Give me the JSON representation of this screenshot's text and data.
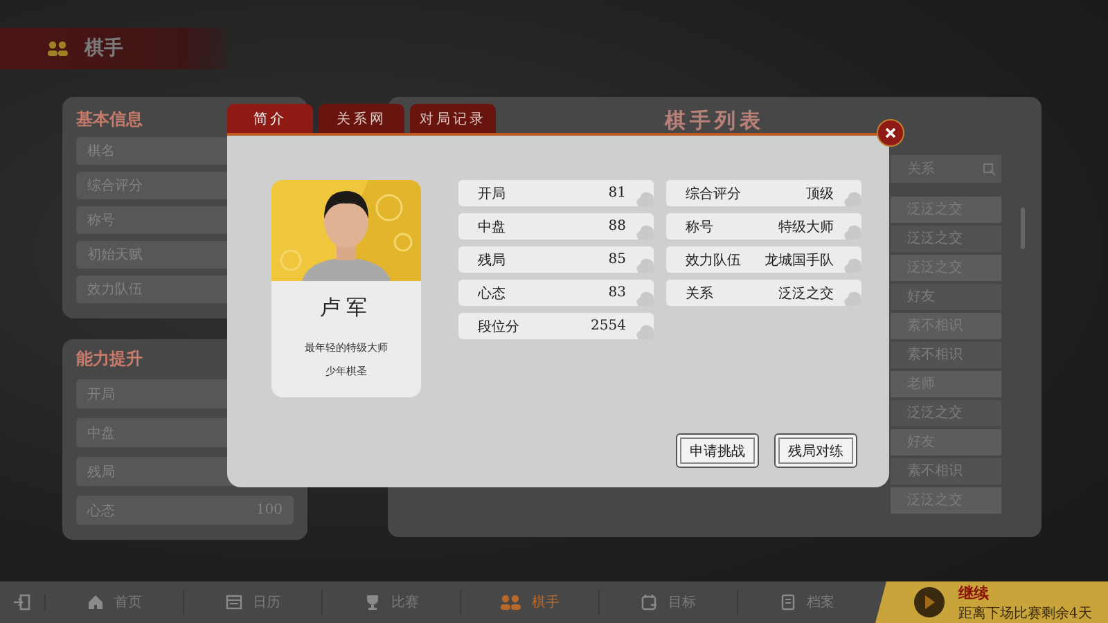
{
  "header": {
    "title": "棋手"
  },
  "basic_info": {
    "title": "基本信息",
    "rows": [
      {
        "label": "棋名"
      },
      {
        "label": "综合评分"
      },
      {
        "label": "称号"
      },
      {
        "label": "初始天赋"
      },
      {
        "label": "效力队伍"
      }
    ]
  },
  "ability": {
    "title": "能力提升",
    "rows": [
      {
        "label": "开局"
      },
      {
        "label": "中盘"
      },
      {
        "label": "残局"
      },
      {
        "label": "心态",
        "value": "100"
      }
    ]
  },
  "player_list": {
    "title": "棋手列表",
    "column": "关系",
    "cells": [
      "泛泛之交",
      "泛泛之交",
      "泛泛之交",
      "好友",
      "素不相识",
      "素不相识",
      "老师",
      "泛泛之交",
      "好友",
      "素不相识",
      "泛泛之交"
    ]
  },
  "nav": [
    {
      "label": "首页",
      "selected": false
    },
    {
      "label": "日历",
      "selected": false
    },
    {
      "label": "比赛",
      "selected": false
    },
    {
      "label": "棋手",
      "selected": true
    },
    {
      "label": "目标",
      "selected": false
    },
    {
      "label": "档案",
      "selected": false
    }
  ],
  "continue": {
    "label": "继续",
    "subtitle": "距离下场比赛剩余4天"
  },
  "dialog": {
    "tabs": [
      {
        "label": "简介",
        "selected": true
      },
      {
        "label": "关系网",
        "selected": false
      },
      {
        "label": "对局记录",
        "selected": false
      }
    ],
    "player": {
      "name": "卢军",
      "bio": [
        "最年轻的特级大师",
        "少年棋圣"
      ]
    },
    "stats": [
      {
        "label": "开局",
        "value": "81"
      },
      {
        "label": "中盘",
        "value": "88"
      },
      {
        "label": "残局",
        "value": "85"
      },
      {
        "label": "心态",
        "value": "83"
      },
      {
        "label": "段位分",
        "value": "2554"
      }
    ],
    "info": [
      {
        "label": "综合评分",
        "value": "顶级"
      },
      {
        "label": "称号",
        "value": "特级大师"
      },
      {
        "label": "效力队伍",
        "value": "龙城国手队"
      },
      {
        "label": "关系",
        "value": "泛泛之交"
      }
    ],
    "buttons": [
      "申请挑战",
      "残局对练"
    ]
  }
}
